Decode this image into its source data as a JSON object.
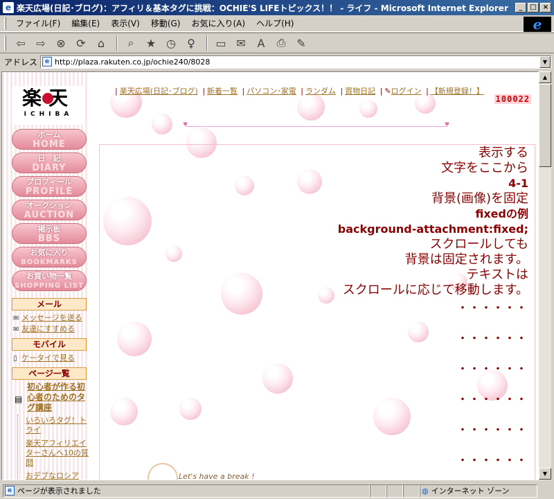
{
  "window": {
    "title": "楽天広場(日記･ブログ)：アフィリ＆基本タグに挑戦：OCHIE'S LIFEトピックス！！ - ライフ - Microsoft Internet Explorer",
    "ie_logo": "e",
    "min": "_",
    "max": "□",
    "close": "×"
  },
  "menu": [
    "ファイル(F)",
    "編集(E)",
    "表示(V)",
    "移動(G)",
    "お気に入り(A)",
    "ヘルプ(H)"
  ],
  "address": {
    "label": "アドレス",
    "url": "http://plaza.rakuten.co.jp/ochie240/8028"
  },
  "logo": {
    "kanji": "楽天",
    "sub": "ICHIBA"
  },
  "nav": [
    {
      "jp": "ホーム",
      "en": "HOME"
    },
    {
      "jp": "日　記",
      "en": "DIARY"
    },
    {
      "jp": "プロフィール",
      "en": "PROFILE"
    },
    {
      "jp": "オークション",
      "en": "AUCTION"
    },
    {
      "jp": "掲示板",
      "en": "BBS"
    },
    {
      "jp": "お気に入り",
      "en": "BOOKMARKS"
    },
    {
      "jp": "お買い物一覧",
      "en": "SHOPPING LIST"
    }
  ],
  "mail": {
    "head": "メール",
    "send": "メッセージを送る",
    "recommend": "友達にすすめる"
  },
  "mobile": {
    "head": "モバイル",
    "link": "ケータイで見る"
  },
  "pages": {
    "head": "ページ一覧",
    "title": "初心者が作る初心者のためのタグ講座",
    "items": [
      "いろいろタグ！トライ",
      "楽天アフィリエイターさんへ10の質問",
      "おデブなロシア"
    ]
  },
  "toplinks": [
    "楽天広場(日記･ブログ)",
    "新着一覧",
    "パソコン･家電",
    "ランダム",
    "買物日記",
    "ログイン",
    "【新規登録！】"
  ],
  "counter": "100022",
  "text": {
    "l1": "表示する",
    "l2": "文字をここから",
    "l3": "4-1",
    "l4": "背景(画像)を固定",
    "l5": "fixedの例",
    "l6": "background-attachment:fixed;",
    "l7": "スクロールしても",
    "l8": "背景は固定されます。",
    "l9": "テキストは",
    "l10": "スクロールに応じて移動します。",
    "dots": "・・・・・・"
  },
  "break_text": "Let's have a break !",
  "status": {
    "left": "ページが表示されました",
    "zone": "インターネット ゾーン"
  }
}
